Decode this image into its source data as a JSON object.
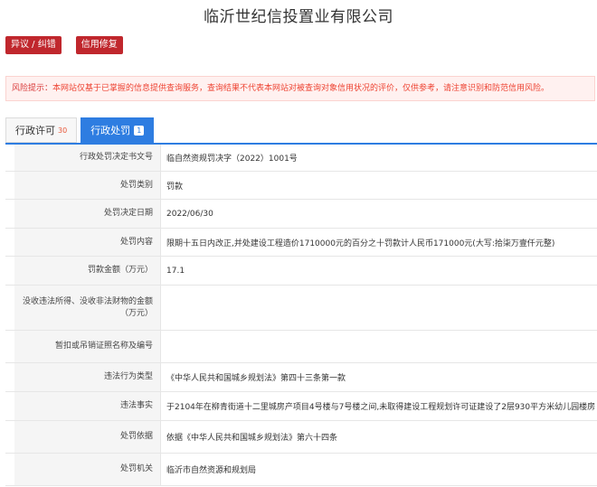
{
  "header": {
    "company_name": "临沂世纪信投置业有限公司"
  },
  "actions": {
    "objection_label": "异议 / 纠错",
    "credit_repair_label": "信用修复"
  },
  "risk_notice": {
    "label": "风险提示：",
    "text": "本网站仅基于已掌握的信息提供查询服务，查询结果不代表本网站对被查询对象信用状况的评价，仅供参考，请注意识别和防范信用风险。"
  },
  "tabs": [
    {
      "label": "行政许可",
      "count": "30"
    },
    {
      "label": "行政处罚",
      "count": "1"
    }
  ],
  "record": {
    "rows": [
      {
        "label": "行政处罚决定书文号",
        "value": "临自然资规罚决字（2022）1001号"
      },
      {
        "label": "处罚类别",
        "value": "罚款"
      },
      {
        "label": "处罚决定日期",
        "value": "2022/06/30"
      },
      {
        "label": "处罚内容",
        "value": "限期十五日内改正,并处建设工程造价1710000元的百分之十罚款计人民币171000元(大写:拾柒万壹仟元整)"
      },
      {
        "label": "罚款金额（万元）",
        "value": "17.1"
      },
      {
        "label": "没收违法所得、没收非法财物的金额（万元）",
        "value": ""
      },
      {
        "label": "暂扣或吊销证照名称及编号",
        "value": ""
      },
      {
        "label": "违法行为类型",
        "value": "《中华人民共和国城乡规划法》第四十三条第一款"
      },
      {
        "label": "违法事实",
        "value": "于2104年在柳青街道十二里城房产项目4号楼与7号楼之间,未取得建设工程规划许可证建设了2层930平方米幼儿园楼房"
      },
      {
        "label": "处罚依据",
        "value": "依据《中华人民共和国城乡规划法》第六十四条"
      },
      {
        "label": "处罚机关",
        "value": "临沂市自然资源和规划局"
      }
    ]
  }
}
